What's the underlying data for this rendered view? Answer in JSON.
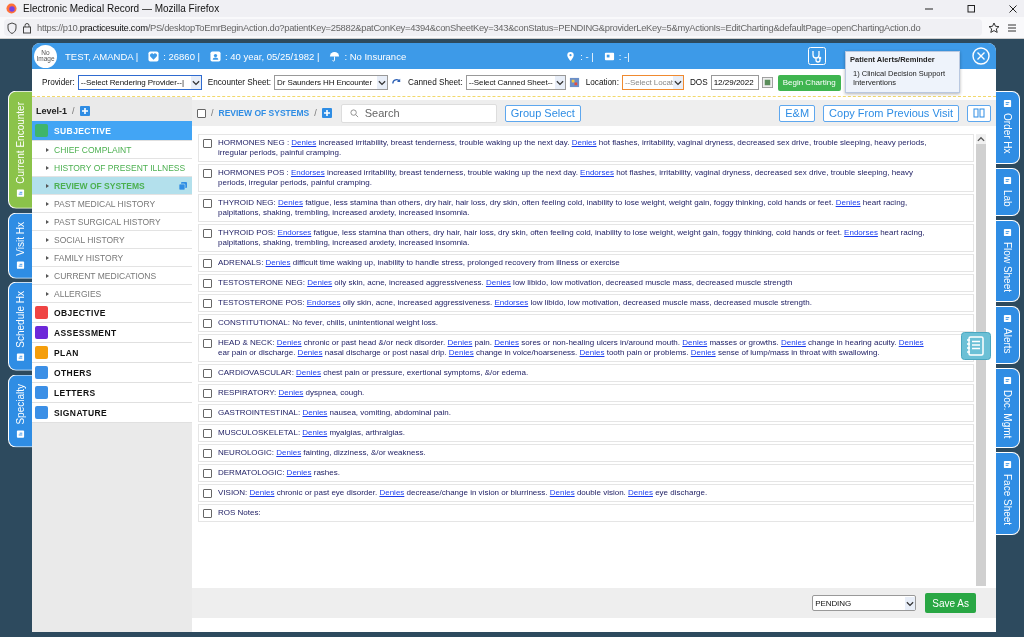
{
  "browser": {
    "title": "Electronic Medical Record — Mozilla Firefox",
    "url": "https://p10.**practicesuite.com**/PS/desktopToEmrBeginAction.do?patientKey=25882&patConKey=4394&conSheetKey=343&conStatus=PENDING&providerLeKey=5&myActionIs=EditCharting&defaultPage=openChartingAction.do"
  },
  "left_tabs": [
    {
      "label": "Current Encounter",
      "selected": true
    },
    {
      "label": "Visit Hx",
      "selected": false
    },
    {
      "label": "Schedule Hx",
      "selected": false
    },
    {
      "label": "Specialty",
      "selected": false
    }
  ],
  "right_tabs": [
    {
      "label": "Order Hx"
    },
    {
      "label": "Lab"
    },
    {
      "label": "Flow Sheet"
    },
    {
      "label": "Alerts"
    },
    {
      "label": "Doc. Mgmt"
    },
    {
      "label": "Face Sheet"
    }
  ],
  "patient": {
    "photo": "No Image",
    "name": "TEST, AMANDA |",
    "chart_number": ": 26860 |",
    "age_dob": ": 40 year, 05/25/1982 |",
    "insurance": ": No Insurance",
    "location": ": - |",
    "field_6": ": -|"
  },
  "toolbar": {
    "provider_label": "Provider:",
    "provider": "--Select Rendering Provider--|",
    "encounter_label": "Encounter Sheet:",
    "encounter": "Dr Saunders HH Encounter",
    "canned_label": "Canned Sheet:",
    "canned": "--Select Canned Sheet--",
    "location_label": "Location:",
    "location": "--Select Locat",
    "location_highlighted": true,
    "dos_label": "DOS",
    "dos": "12/29/2022",
    "begin_button": "Begin Charting"
  },
  "alert_popup": {
    "title": "Patient Alerts/Reminder",
    "items": [
      "1) Clinical Decision Support Interventions"
    ]
  },
  "sidebar": {
    "level": "Level-1",
    "separator": "/",
    "sections": [
      {
        "label": "SUBJECTIVE",
        "color": "#3fb56b",
        "selected": true,
        "children": [
          {
            "label": "CHIEF COMPLAINT",
            "completed": true,
            "selected": false
          },
          {
            "label": "HISTORY OF PRESENT ILLNESS",
            "completed": true,
            "selected": false
          },
          {
            "label": "REVIEW OF SYSTEMS",
            "completed": true,
            "selected": true
          },
          {
            "label": "PAST MEDICAL HISTORY",
            "completed": false,
            "selected": false
          },
          {
            "label": "PAST SURGICAL HISTORY",
            "completed": false,
            "selected": false
          },
          {
            "label": "SOCIAL HISTORY",
            "completed": false,
            "selected": false
          },
          {
            "label": "FAMILY HISTORY",
            "completed": false,
            "selected": false
          },
          {
            "label": "CURRENT MEDICATIONS",
            "completed": false,
            "selected": false
          },
          {
            "label": "ALLERGIES",
            "completed": false,
            "selected": false
          }
        ]
      },
      {
        "label": "OBJECTIVE",
        "color": "#ef4444",
        "selected": false
      },
      {
        "label": "ASSESSMENT",
        "color": "#6d28d9",
        "selected": false
      },
      {
        "label": "PLAN",
        "color": "#f59e0b",
        "selected": false
      },
      {
        "label": "OTHERS",
        "color": "#3b8fe6",
        "selected": false
      },
      {
        "label": "LETTERS",
        "color": "#3b8fe6",
        "selected": false
      },
      {
        "label": "SIGNATURE",
        "color": "#3b8fe6",
        "selected": false
      }
    ]
  },
  "content": {
    "select_all_checked": false,
    "separator_before": "/",
    "title": "REVIEW OF SYSTEMS",
    "separator_after": "/",
    "search": {
      "placeholder": "Search"
    },
    "group_select": "Group Select",
    "em_button": "E&M",
    "copy_button": "Copy From Previous Visit",
    "rows": [
      {
        "checked": false,
        "parts": [
          {
            "kind": "text",
            "text": "HORMONES NEG : "
          },
          {
            "kind": "link",
            "text": "Denies"
          },
          {
            "kind": "text",
            "text": " increased irritability, breast tenderness, trouble waking up the next day. "
          },
          {
            "kind": "link",
            "text": "Denies"
          },
          {
            "kind": "text",
            "text": " hot flashes, irritability, vaginal dryness, decreased sex drive, trouble sleeping, heavy periods, irregular periods, painful cramping."
          }
        ]
      },
      {
        "checked": false,
        "parts": [
          {
            "kind": "text",
            "text": "HORMONES POS : "
          },
          {
            "kind": "link",
            "text": "Endorses"
          },
          {
            "kind": "text",
            "text": " increased irritability, breast tenderness, trouble waking up the next day. "
          },
          {
            "kind": "link",
            "text": "Endorses"
          },
          {
            "kind": "text",
            "text": " hot flashes, irritability, vaginal dryness, decreased sex drive, trouble sleeping, heavy periods, irregular periods, painful cramping."
          }
        ]
      },
      {
        "checked": false,
        "parts": [
          {
            "kind": "text",
            "text": "THYROID NEG: "
          },
          {
            "kind": "link",
            "text": "Denies"
          },
          {
            "kind": "text",
            "text": " fatigue, less stamina than others, dry hair, hair loss, dry skin, often feeling cold, inability to lose weight, weight gain, foggy thinking, cold hands or feet. "
          },
          {
            "kind": "link",
            "text": "Denies"
          },
          {
            "kind": "text",
            "text": " heart racing, palpitations, shaking, trembling, increased anxiety, increased insomnia."
          }
        ]
      },
      {
        "checked": false,
        "parts": [
          {
            "kind": "text",
            "text": "THYROID POS: "
          },
          {
            "kind": "link",
            "text": "Endorses"
          },
          {
            "kind": "text",
            "text": " fatigue, less stamina than others, dry hair, hair loss, dry skin, often feeling cold, inability to lose weight, weight gain, foggy thinking, cold hands or feet. "
          },
          {
            "kind": "link",
            "text": "Endorses"
          },
          {
            "kind": "text",
            "text": " heart racing, palpitations, shaking, trembling, increased anxiety, increased insomnia."
          }
        ]
      },
      {
        "checked": false,
        "parts": [
          {
            "kind": "text",
            "text": "ADRENALS: "
          },
          {
            "kind": "link",
            "text": "Denies"
          },
          {
            "kind": "text",
            "text": " difficult time waking up, inability to handle stress, prolonged recovery from illness or exercise"
          }
        ]
      },
      {
        "checked": false,
        "parts": [
          {
            "kind": "text",
            "text": "TESTOSTERONE NEG: "
          },
          {
            "kind": "link",
            "text": "Denies"
          },
          {
            "kind": "text",
            "text": " oily skin, acne, increased aggressiveness. "
          },
          {
            "kind": "link",
            "text": "Denies"
          },
          {
            "kind": "text",
            "text": " low libido, low motivation, decreased muscle mass, decreased muscle strength"
          }
        ]
      },
      {
        "checked": false,
        "parts": [
          {
            "kind": "text",
            "text": "TESTOSTERONE POS: "
          },
          {
            "kind": "link",
            "text": "Endorses"
          },
          {
            "kind": "text",
            "text": " oily skin, acne, increased aggressiveness. "
          },
          {
            "kind": "link",
            "text": "Endorses"
          },
          {
            "kind": "text",
            "text": " low libido, low motivation, decreased muscle mass, decreased muscle strength."
          }
        ]
      },
      {
        "checked": false,
        "parts": [
          {
            "kind": "text",
            "text": "CONSTITUTIONAL: No fever, chills, unintentional weight loss."
          }
        ]
      },
      {
        "checked": false,
        "parts": [
          {
            "kind": "text",
            "text": "HEAD & NECK: "
          },
          {
            "kind": "link",
            "text": "Denies"
          },
          {
            "kind": "text",
            "text": " chronic or past head &/or neck disorder. "
          },
          {
            "kind": "link",
            "text": "Denies"
          },
          {
            "kind": "text",
            "text": " pain. "
          },
          {
            "kind": "link",
            "text": "Denies"
          },
          {
            "kind": "text",
            "text": " sores or non-healing ulcers in/around mouth. "
          },
          {
            "kind": "link",
            "text": "Denies"
          },
          {
            "kind": "text",
            "text": " masses or growths. "
          },
          {
            "kind": "link",
            "text": "Denies"
          },
          {
            "kind": "text",
            "text": " change in hearing acuity. "
          },
          {
            "kind": "link",
            "text": "Denies"
          },
          {
            "kind": "text",
            "text": " ear pain or discharge. "
          },
          {
            "kind": "link",
            "text": "Denies"
          },
          {
            "kind": "text",
            "text": " nasal discharge or post nasal drip. "
          },
          {
            "kind": "link",
            "text": "Denies"
          },
          {
            "kind": "text",
            "text": " change in voice/hoarseness. "
          },
          {
            "kind": "link",
            "text": "Denies"
          },
          {
            "kind": "text",
            "text": " tooth pain or problems. "
          },
          {
            "kind": "link",
            "text": "Denies"
          },
          {
            "kind": "text",
            "text": " sense of lump/mass in throat with swallowing."
          }
        ]
      },
      {
        "checked": false,
        "parts": [
          {
            "kind": "text",
            "text": "CARDIOVASCULAR: "
          },
          {
            "kind": "link",
            "text": "Denies"
          },
          {
            "kind": "text",
            "text": " chest pain or pressure, exertional symptoms, &/or edema."
          }
        ]
      },
      {
        "checked": false,
        "parts": [
          {
            "kind": "text",
            "text": "RESPIRATORY: "
          },
          {
            "kind": "link",
            "text": "Denies"
          },
          {
            "kind": "text",
            "text": " dyspnea, cough."
          }
        ]
      },
      {
        "checked": false,
        "parts": [
          {
            "kind": "text",
            "text": "GASTROINTESTINAL: "
          },
          {
            "kind": "link",
            "text": "Denies"
          },
          {
            "kind": "text",
            "text": " nausea, vomiting, abdominal pain."
          }
        ]
      },
      {
        "checked": false,
        "parts": [
          {
            "kind": "text",
            "text": "MUSCULOSKELETAL: "
          },
          {
            "kind": "link",
            "text": "Denies"
          },
          {
            "kind": "text",
            "text": " myalgias, arthralgias."
          }
        ]
      },
      {
        "checked": false,
        "parts": [
          {
            "kind": "text",
            "text": "NEUROLOGIC: "
          },
          {
            "kind": "link",
            "text": "Denies"
          },
          {
            "kind": "text",
            "text": " fainting, dizziness, &/or weakness."
          }
        ]
      },
      {
        "checked": false,
        "parts": [
          {
            "kind": "text",
            "text": "DERMATOLOGIC: "
          },
          {
            "kind": "link",
            "text": "Denies"
          },
          {
            "kind": "text",
            "text": " rashes."
          }
        ]
      },
      {
        "checked": false,
        "parts": [
          {
            "kind": "text",
            "text": "VISION: "
          },
          {
            "kind": "link",
            "text": "Denies"
          },
          {
            "kind": "text",
            "text": " chronic or past eye disorder. "
          },
          {
            "kind": "link",
            "text": "Denies"
          },
          {
            "kind": "text",
            "text": " decrease/change in vision or blurriness. "
          },
          {
            "kind": "link",
            "text": "Denies"
          },
          {
            "kind": "text",
            "text": " double vision. "
          },
          {
            "kind": "link",
            "text": "Denies"
          },
          {
            "kind": "text",
            "text": " eye discharge."
          }
        ]
      },
      {
        "checked": false,
        "parts": [
          {
            "kind": "text",
            "text": "ROS Notes:"
          }
        ]
      }
    ]
  },
  "footer": {
    "status": "PENDING",
    "save_button": "Save As"
  }
}
